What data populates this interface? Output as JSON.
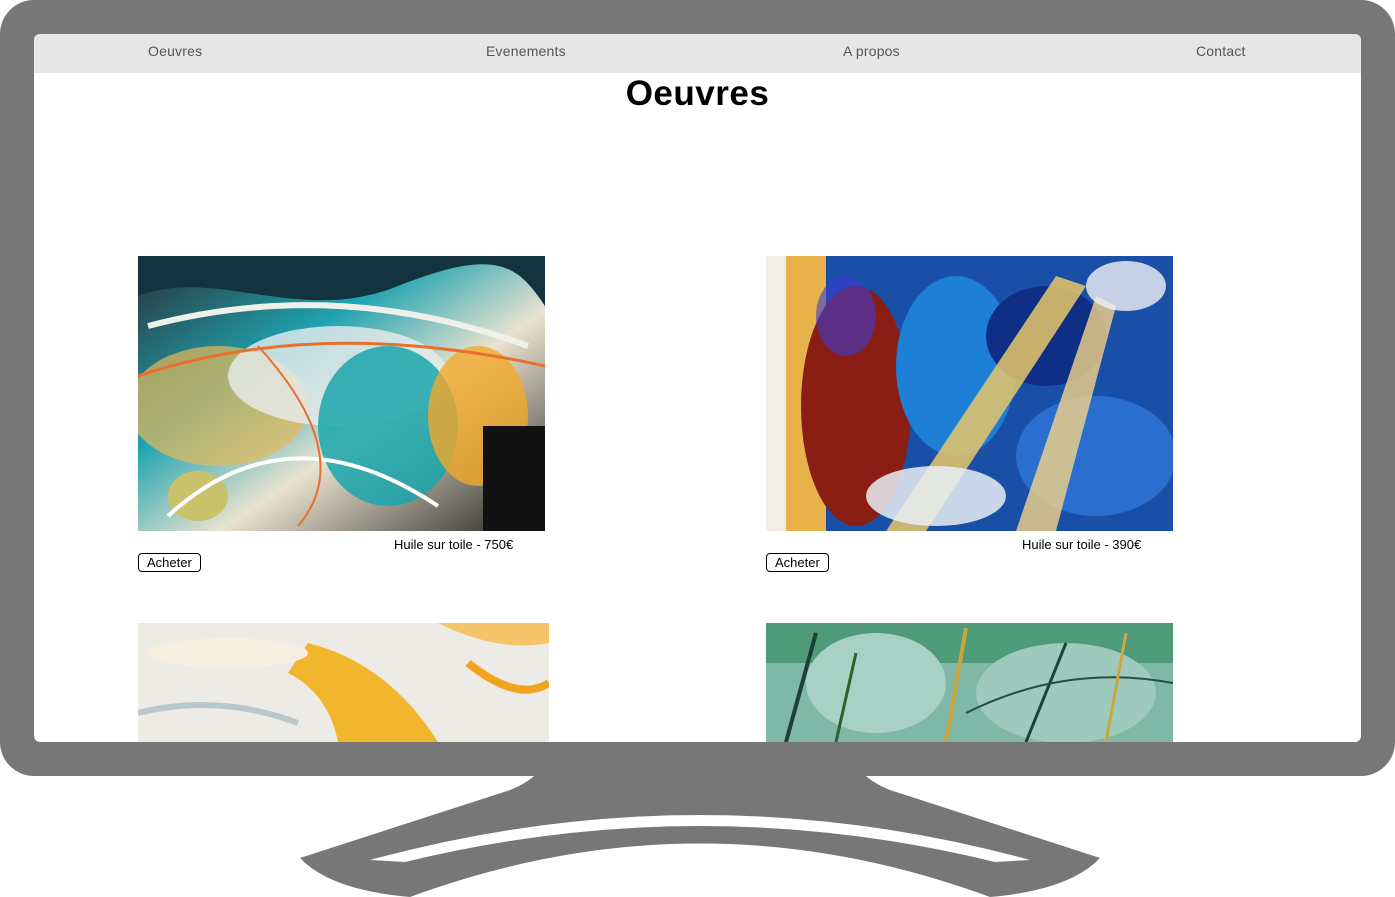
{
  "nav": {
    "items": [
      {
        "label": "Oeuvres"
      },
      {
        "label": "Evenements"
      },
      {
        "label": "A propos"
      },
      {
        "label": "Contact"
      }
    ]
  },
  "page": {
    "title": "Oeuvres"
  },
  "artworks": [
    {
      "caption": "Huile sur toile - 750€",
      "button": "Acheter"
    },
    {
      "caption": "Huile sur toile - 390€",
      "button": "Acheter"
    },
    {
      "caption": "",
      "button": ""
    },
    {
      "caption": "",
      "button": ""
    }
  ],
  "colors": {
    "frame": "#777777",
    "nav_background": "#e6e6e6",
    "nav_text": "#555555"
  }
}
